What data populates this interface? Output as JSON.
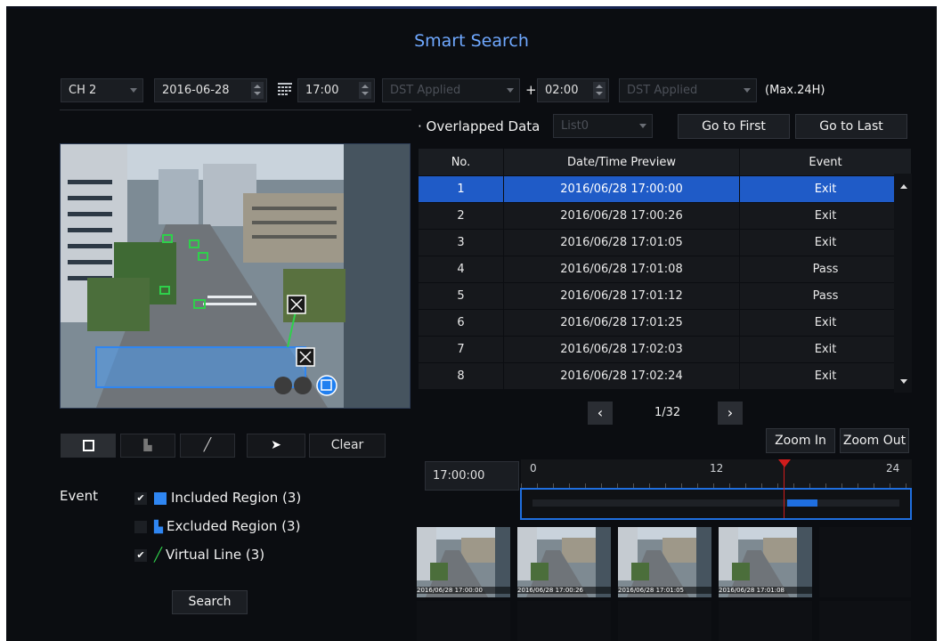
{
  "title": "Smart Search",
  "filters": {
    "channel": "CH 2",
    "date": "2016-06-28",
    "time": "17:00",
    "dst1": "DST Applied",
    "plus": "+",
    "duration": "02:00",
    "dst2": "DST Applied",
    "max_note": "(Max.24H)"
  },
  "overlap": {
    "label": "Overlapped Data",
    "list_value": "List0"
  },
  "buttons": {
    "go_first": "Go to First",
    "go_last": "Go to Last",
    "zoom_in": "Zoom In",
    "zoom_out": "Zoom Out",
    "clear": "Clear",
    "search": "Search"
  },
  "table": {
    "headers": [
      "No.",
      "Date/Time Preview",
      "Event"
    ],
    "rows": [
      {
        "no": "1",
        "datetime": "2016/06/28 17:00:00",
        "event": "Exit"
      },
      {
        "no": "2",
        "datetime": "2016/06/28 17:00:26",
        "event": "Exit"
      },
      {
        "no": "3",
        "datetime": "2016/06/28 17:01:05",
        "event": "Exit"
      },
      {
        "no": "4",
        "datetime": "2016/06/28 17:01:08",
        "event": "Pass"
      },
      {
        "no": "5",
        "datetime": "2016/06/28 17:01:12",
        "event": "Pass"
      },
      {
        "no": "6",
        "datetime": "2016/06/28 17:01:25",
        "event": "Exit"
      },
      {
        "no": "7",
        "datetime": "2016/06/28 17:02:03",
        "event": "Exit"
      },
      {
        "no": "8",
        "datetime": "2016/06/28 17:02:24",
        "event": "Exit"
      }
    ],
    "selected_row": 1
  },
  "pagination": {
    "text": "1/32"
  },
  "timeline": {
    "time": "17:00:00",
    "ticks": [
      "0",
      "12",
      "24"
    ]
  },
  "event": {
    "label": "Event",
    "included": "Included Region (3)",
    "excluded": "Excluded Region (3)",
    "virtual": "Virtual Line (3)"
  },
  "thumbs": [
    "2016/06/28 17:00:00",
    "2016/06/28 17:00:26",
    "2016/06/28 17:01:05",
    "2016/06/28 17:01:08"
  ],
  "colors": {
    "accent": "#1f5bc7",
    "title": "#6fa8ff",
    "marker": "#d01c1c"
  }
}
